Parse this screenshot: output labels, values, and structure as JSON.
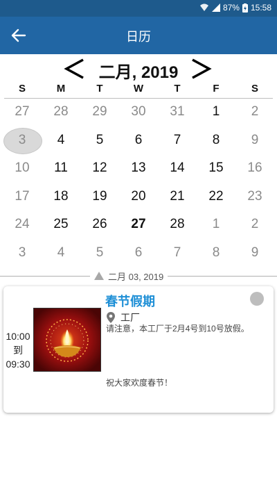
{
  "status_bar": {
    "battery": "87%",
    "time": "15:58"
  },
  "header": {
    "title": "日历"
  },
  "calendar": {
    "month_label": "二月, 2019",
    "weekdays": [
      "S",
      "M",
      "T",
      "W",
      "T",
      "F",
      "S"
    ],
    "weeks": [
      [
        {
          "d": "27",
          "out": true
        },
        {
          "d": "28",
          "out": true
        },
        {
          "d": "29",
          "out": true
        },
        {
          "d": "30",
          "out": true
        },
        {
          "d": "31",
          "out": true
        },
        {
          "d": "1"
        },
        {
          "d": "2",
          "out": true
        }
      ],
      [
        {
          "d": "3",
          "out": true,
          "selected": true
        },
        {
          "d": "4"
        },
        {
          "d": "5"
        },
        {
          "d": "6"
        },
        {
          "d": "7"
        },
        {
          "d": "8"
        },
        {
          "d": "9",
          "out": true
        }
      ],
      [
        {
          "d": "10",
          "out": true
        },
        {
          "d": "11"
        },
        {
          "d": "12"
        },
        {
          "d": "13"
        },
        {
          "d": "14"
        },
        {
          "d": "15"
        },
        {
          "d": "16",
          "out": true
        }
      ],
      [
        {
          "d": "17",
          "out": true
        },
        {
          "d": "18"
        },
        {
          "d": "19"
        },
        {
          "d": "20"
        },
        {
          "d": "21"
        },
        {
          "d": "22"
        },
        {
          "d": "23",
          "out": true
        }
      ],
      [
        {
          "d": "24",
          "out": true
        },
        {
          "d": "25"
        },
        {
          "d": "26"
        },
        {
          "d": "27",
          "today": true
        },
        {
          "d": "28"
        },
        {
          "d": "1",
          "out": true
        },
        {
          "d": "2",
          "out": true
        }
      ],
      [
        {
          "d": "3",
          "out": true
        },
        {
          "d": "4",
          "out": true
        },
        {
          "d": "5",
          "out": true
        },
        {
          "d": "6",
          "out": true
        },
        {
          "d": "7",
          "out": true
        },
        {
          "d": "8",
          "out": true
        },
        {
          "d": "9",
          "out": true
        }
      ]
    ]
  },
  "selected_date_label": "二月 03, 2019",
  "event": {
    "time_start": "10:00",
    "time_sep": "到",
    "time_end": "09:30",
    "title": "春节假期",
    "location": "工厂",
    "description": "请注意，本工厂于2月4号到10号放假。",
    "note": "祝大家欢度春节！"
  },
  "colors": {
    "status_bar": "#1e5a8c",
    "app_bar": "#2166a4",
    "event_title": "#1e8fd6"
  }
}
